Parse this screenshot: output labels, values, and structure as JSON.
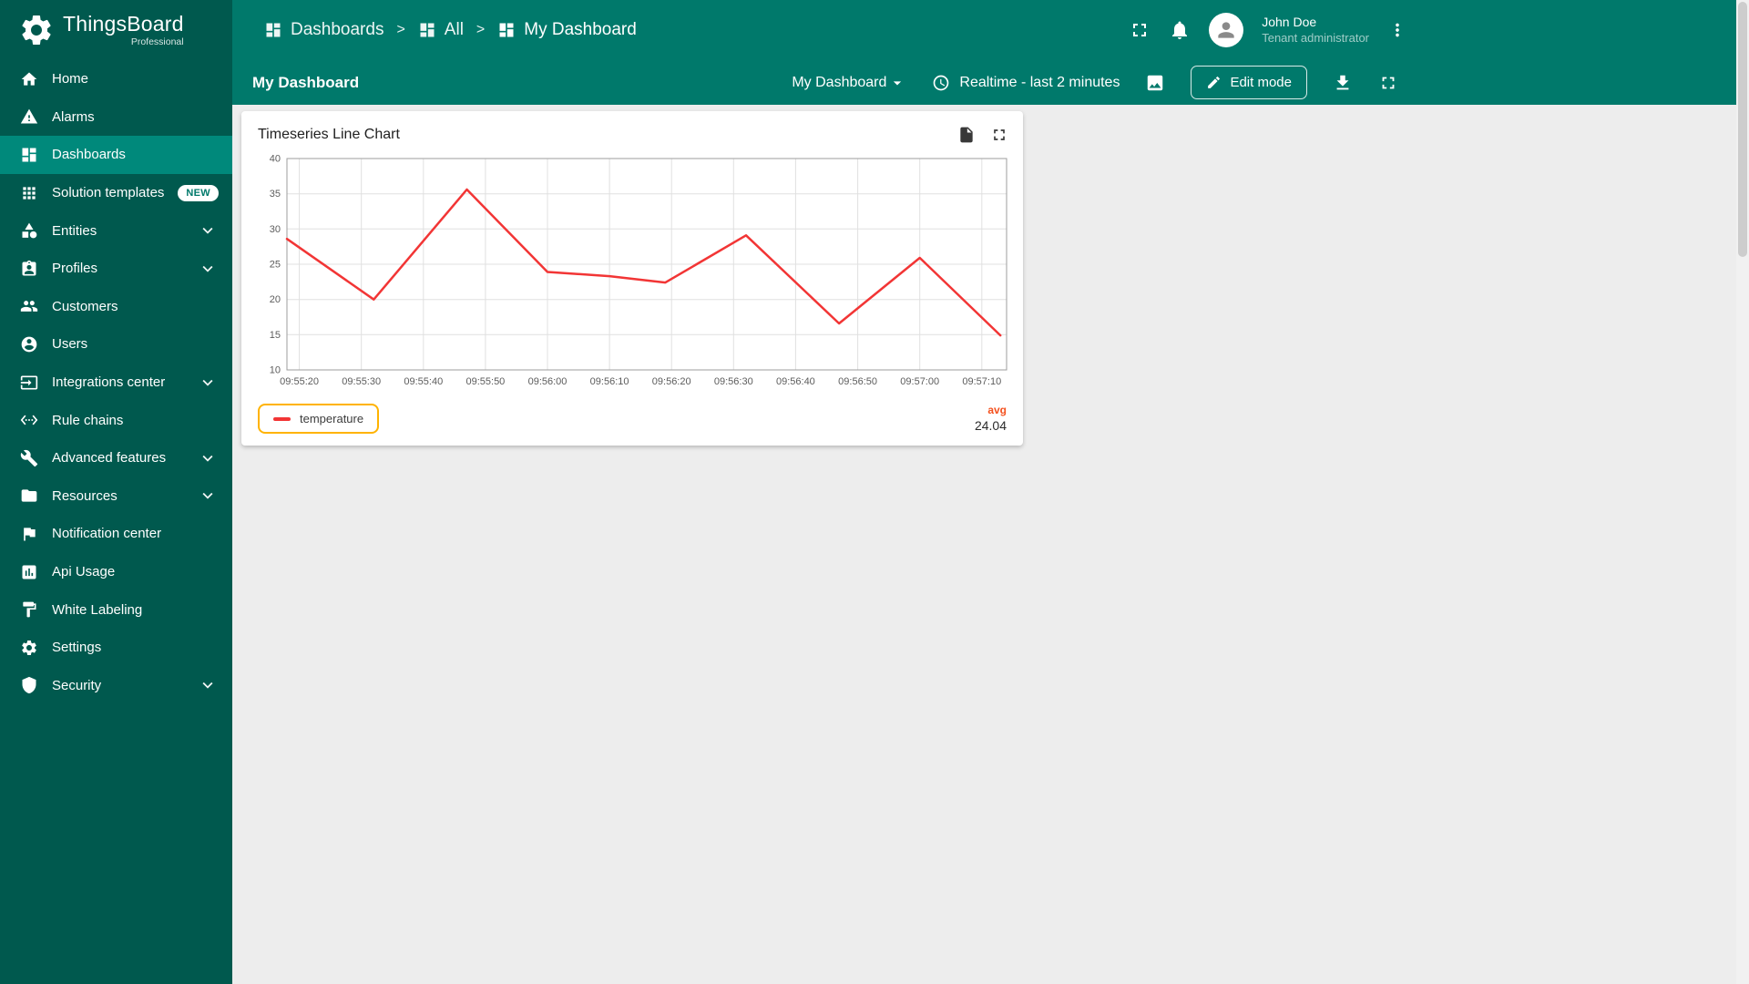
{
  "theme": {
    "header_bg": "#00796b",
    "sidebar_bg": "#00594e",
    "active_item_bg": "#00897b",
    "content_bg": "#ededed",
    "line_color": "#f23535",
    "avg_label_color": "#f4511e",
    "legend_highlight": "#ffb300"
  },
  "logo": {
    "title": "ThingsBoard",
    "subtitle": "Professional"
  },
  "sidebar": {
    "items": [
      {
        "label": "Home",
        "icon": "home"
      },
      {
        "label": "Alarms",
        "icon": "warning"
      },
      {
        "label": "Dashboards",
        "icon": "dashboard",
        "active": true
      },
      {
        "label": "Solution templates",
        "icon": "apps",
        "badge": "NEW"
      },
      {
        "label": "Entities",
        "icon": "category",
        "expandable": true
      },
      {
        "label": "Profiles",
        "icon": "badge",
        "expandable": true
      },
      {
        "label": "Customers",
        "icon": "people"
      },
      {
        "label": "Users",
        "icon": "account"
      },
      {
        "label": "Integrations center",
        "icon": "input",
        "expandable": true
      },
      {
        "label": "Rule chains",
        "icon": "ethernet"
      },
      {
        "label": "Advanced features",
        "icon": "build",
        "expandable": true
      },
      {
        "label": "Resources",
        "icon": "folder",
        "expandable": true
      },
      {
        "label": "Notification center",
        "icon": "flag"
      },
      {
        "label": "Api Usage",
        "icon": "chart"
      },
      {
        "label": "White Labeling",
        "icon": "paint"
      },
      {
        "label": "Settings",
        "icon": "settings"
      },
      {
        "label": "Security",
        "icon": "shield",
        "expandable": true
      }
    ]
  },
  "header": {
    "breadcrumb": {
      "separator": ">",
      "items": [
        {
          "label": "Dashboards",
          "icon": "dashboard"
        },
        {
          "label": "All",
          "icon": "dashboard"
        },
        {
          "label": "My Dashboard",
          "icon": "dashboard",
          "current": true
        }
      ]
    },
    "icons": [
      "fullscreen-icon",
      "notifications-icon",
      "more-vert-icon"
    ],
    "user": {
      "name": "John Doe",
      "role": "Tenant administrator"
    }
  },
  "toolbar": {
    "title": "My Dashboard",
    "dashboard_select_label": "My Dashboard",
    "timewindow_label": "Realtime - last 2 minutes",
    "edit_button_label": "Edit mode",
    "icons": [
      "image-icon",
      "edit-icon",
      "download-icon",
      "fullscreen-icon"
    ]
  },
  "widget": {
    "title": "Timeseries Line Chart",
    "action_icons": [
      "export-icon",
      "fullscreen-icon"
    ],
    "legend": {
      "series_label": "temperature",
      "agg_label": "avg",
      "agg_value": "24.04"
    }
  },
  "chart_data": {
    "type": "line",
    "title": "Timeseries Line Chart",
    "x_axis": {
      "min": 0,
      "max": 116,
      "ticks": [
        {
          "offset": 2,
          "label": "09:55:20"
        },
        {
          "offset": 12,
          "label": "09:55:30"
        },
        {
          "offset": 22,
          "label": "09:55:40"
        },
        {
          "offset": 32,
          "label": "09:55:50"
        },
        {
          "offset": 42,
          "label": "09:56:00"
        },
        {
          "offset": 52,
          "label": "09:56:10"
        },
        {
          "offset": 62,
          "label": "09:56:20"
        },
        {
          "offset": 72,
          "label": "09:56:30"
        },
        {
          "offset": 82,
          "label": "09:56:40"
        },
        {
          "offset": 92,
          "label": "09:56:50"
        },
        {
          "offset": 102,
          "label": "09:57:00"
        },
        {
          "offset": 112,
          "label": "09:57:10"
        }
      ]
    },
    "y_axis": {
      "min": 10,
      "max": 40,
      "ticks": [
        10,
        15,
        20,
        25,
        30,
        35,
        40
      ]
    },
    "grid": {
      "show": true,
      "color": "#e0e0e0",
      "border_color": "#9e9e9e"
    },
    "series": [
      {
        "name": "temperature",
        "color": "#f23535",
        "points": [
          [
            0,
            28.6
          ],
          [
            14,
            20.0
          ],
          [
            29,
            35.6
          ],
          [
            42,
            23.9
          ],
          [
            52,
            23.3
          ],
          [
            61,
            22.4
          ],
          [
            74,
            29.1
          ],
          [
            89,
            16.6
          ],
          [
            102,
            25.9
          ],
          [
            115,
            14.9
          ]
        ]
      }
    ],
    "aggregation": {
      "label": "avg",
      "value": 24.04
    },
    "legend_position": "bottom-left"
  }
}
